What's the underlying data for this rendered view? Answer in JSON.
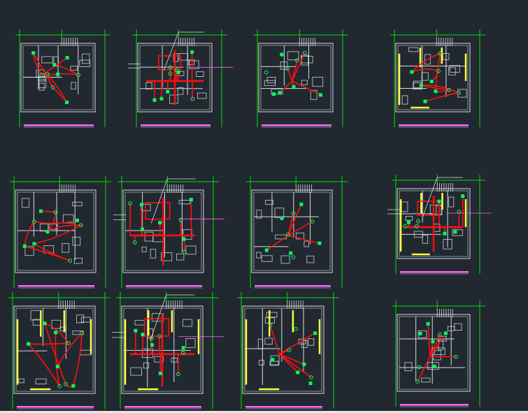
{
  "canvas": {
    "background": "#212830",
    "bottom_bar_color": "#e6e6e6"
  },
  "colors": {
    "wall": "#d8dce0",
    "grid": "#00e000",
    "wire": "#ff1010",
    "device": "#00ff60",
    "title_bar": "#ff66ff",
    "highlight_wall": "#ffff40",
    "pointer_line": "#ff66ff"
  },
  "sheets": [
    {
      "id": "plan-1",
      "row": 1,
      "col": 1,
      "variant": "apartment-a",
      "wiring": "circuit-loop",
      "yellow_walls": false,
      "leader_lines": false
    },
    {
      "id": "plan-2",
      "row": 1,
      "col": 2,
      "variant": "apartment-a",
      "wiring": "trunk",
      "yellow_walls": false,
      "leader_lines": true
    },
    {
      "id": "plan-3",
      "row": 1,
      "col": 3,
      "variant": "apartment-a",
      "wiring": "sparse",
      "yellow_walls": false,
      "leader_lines": false
    },
    {
      "id": "plan-4",
      "row": 1,
      "col": 4,
      "variant": "apartment-b",
      "wiring": "circuit-loop",
      "yellow_walls": true,
      "leader_lines": false
    },
    {
      "id": "plan-5",
      "row": 2,
      "col": 1,
      "variant": "apartment-c",
      "wiring": "circuit-loop",
      "yellow_walls": false,
      "leader_lines": false
    },
    {
      "id": "plan-6",
      "row": 2,
      "col": 2,
      "variant": "apartment-c",
      "wiring": "trunk",
      "yellow_walls": false,
      "leader_lines": true
    },
    {
      "id": "plan-7",
      "row": 2,
      "col": 3,
      "variant": "apartment-c",
      "wiring": "sparse",
      "yellow_walls": false,
      "leader_lines": false
    },
    {
      "id": "plan-8",
      "row": 2,
      "col": 4,
      "variant": "apartment-b",
      "wiring": "trunk",
      "yellow_walls": true,
      "leader_lines": true
    },
    {
      "id": "plan-9",
      "row": 3,
      "col": 1,
      "variant": "apartment-d",
      "wiring": "circuit-loop",
      "yellow_walls": true,
      "leader_lines": false
    },
    {
      "id": "plan-10",
      "row": 3,
      "col": 2,
      "variant": "apartment-d",
      "wiring": "trunk",
      "yellow_walls": true,
      "leader_lines": true
    },
    {
      "id": "plan-11",
      "row": 3,
      "col": 3,
      "variant": "apartment-d",
      "wiring": "sparse",
      "yellow_walls": true,
      "leader_lines": false
    },
    {
      "id": "plan-12",
      "row": 3,
      "col": 4,
      "variant": "apartment-b",
      "wiring": "sparse",
      "yellow_walls": false,
      "leader_lines": false
    }
  ]
}
